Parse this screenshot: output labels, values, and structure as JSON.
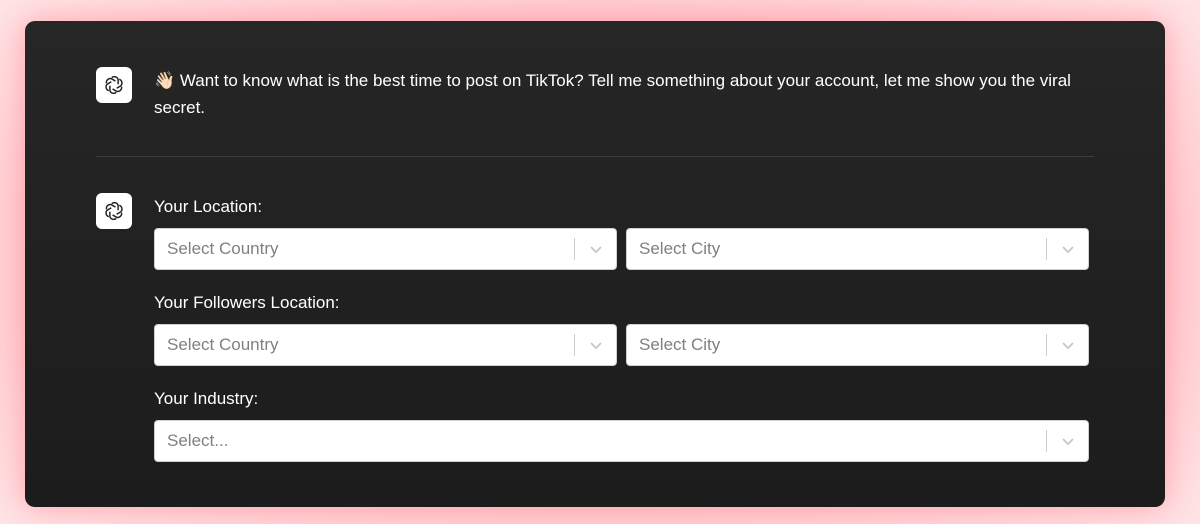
{
  "intro": {
    "message": "👋🏻 Want to know what is the best time to post on TikTok? Tell me something about your account, let me show you the viral secret."
  },
  "form": {
    "location_label": "Your Location:",
    "followers_location_label": "Your Followers Location:",
    "industry_label": "Your Industry:",
    "location_country_placeholder": "Select Country",
    "location_city_placeholder": "Select City",
    "followers_country_placeholder": "Select Country",
    "followers_city_placeholder": "Select City",
    "industry_placeholder": "Select..."
  },
  "icons": {
    "assistant_avatar": "openai-logo-icon",
    "dropdown": "chevron-down-icon"
  },
  "colors": {
    "card_background": "#1e1e1e",
    "page_glow": "#ff8a94",
    "text": "#ffffff",
    "placeholder": "#808080"
  }
}
